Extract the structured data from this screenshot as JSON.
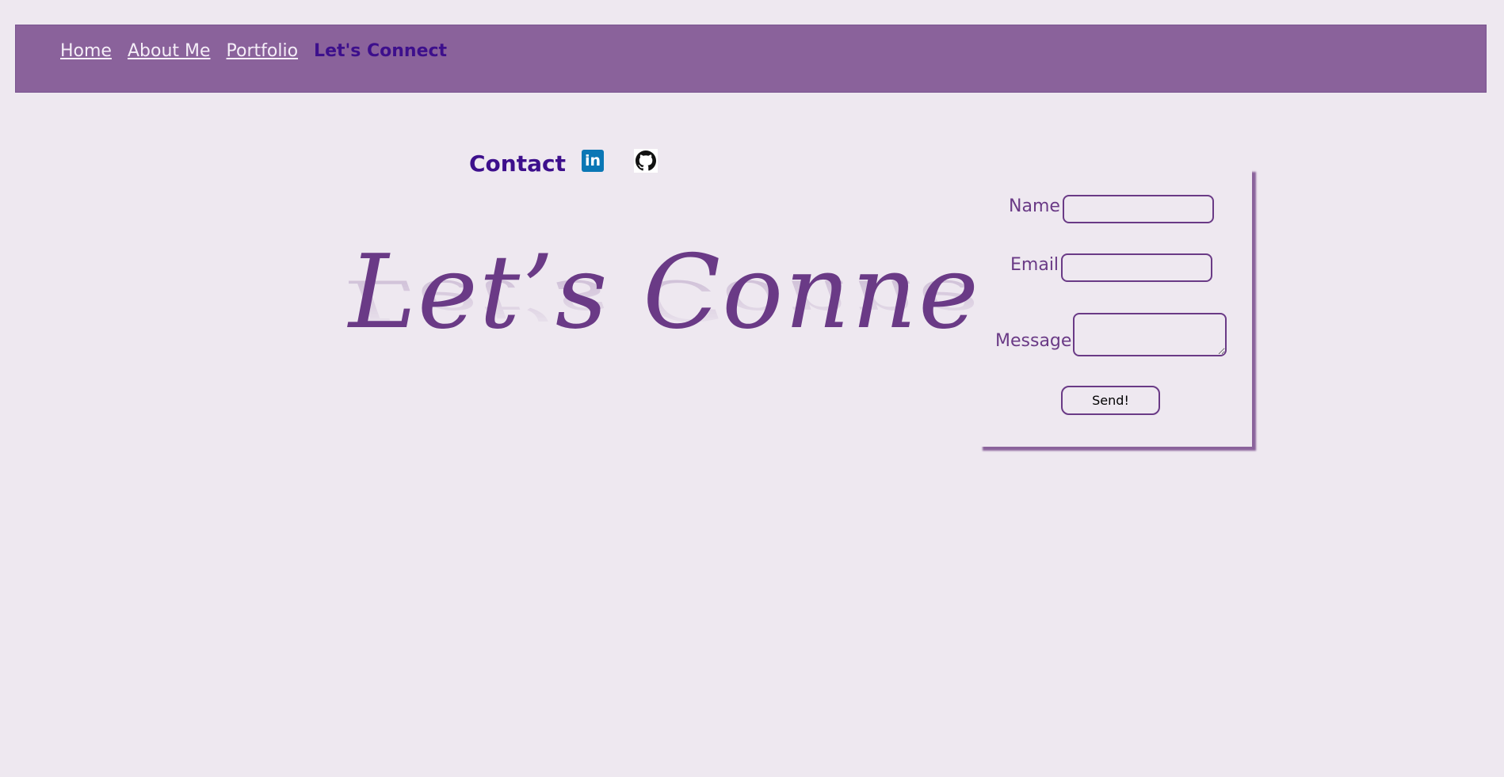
{
  "nav": {
    "items": [
      {
        "label": "Home"
      },
      {
        "label": "About Me"
      },
      {
        "label": "Portfolio"
      },
      {
        "label": "Let's Connect"
      }
    ]
  },
  "contact": {
    "title": "Contact",
    "linkedin_icon_text": "in",
    "icons": [
      "linkedin-icon",
      "github-icon"
    ]
  },
  "banner": {
    "text": "Let’s Connect"
  },
  "form": {
    "name_label": "Name",
    "email_label": "Email",
    "message_label": "Message",
    "name_value": "",
    "email_value": "",
    "message_value": "",
    "send_label": "Send!"
  },
  "colors": {
    "background": "#eee8f0",
    "navbar": "#8a629b",
    "accent": "#3d0f8c",
    "form_text": "#6a3a86",
    "linkedin": "#0a77b5"
  }
}
